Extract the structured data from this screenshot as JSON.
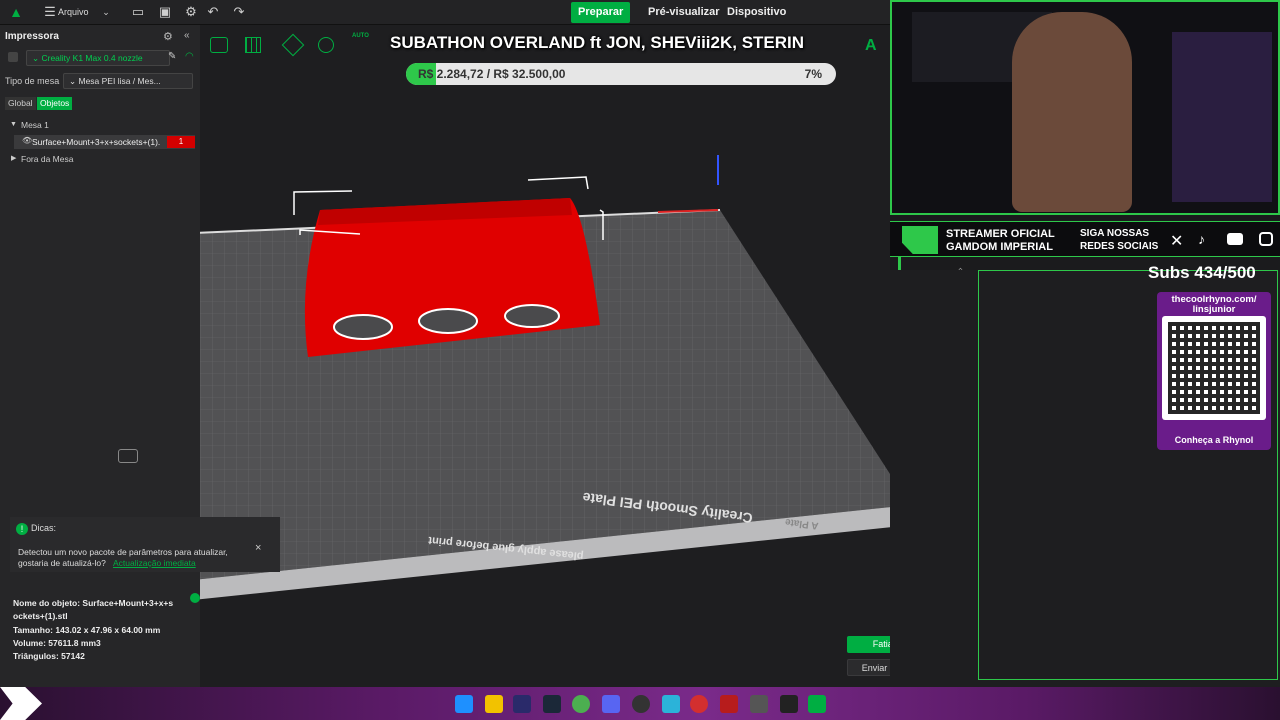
{
  "topbar": {
    "menu_label": "Arquivo",
    "modes": [
      "Preparar",
      "Pré-visualizar",
      "Dispositivo"
    ]
  },
  "overlay": {
    "banner": "SUBATHON OVERLAND ft JON, SHEViii2K, STERIN",
    "goal_text": "R$ 2.284,72 / R$ 32.500,00",
    "goal_percent_label": "7%",
    "goal_fraction": 0.07,
    "streamer_line1": "STREAMER OFICIAL",
    "streamer_line2": "GAMDOM IMPERIAL",
    "social_line1": "SIGA NOSSAS",
    "social_line2": "REDES SOCIAIS",
    "subs": "Subs 434/500",
    "qr_title": "thecoolrhyno.com/ linsjunior",
    "qr_caption": "Conheça a Rhynol"
  },
  "left_panel": {
    "printer_header": "Impressora",
    "printer_value": "Creality K1 Max 0.4 nozzle",
    "bed_label": "Tipo de mesa",
    "bed_value": "Mesa PEI lisa / Mes...",
    "tab_global": "Global",
    "tab_objects": "Objetos",
    "plate_label": "Mesa 1",
    "object_name": "Surface+Mount+3+x+sockets+(1).",
    "object_badge": "1",
    "outside_label": "Fora da Mesa"
  },
  "tips": {
    "title": "Dicas:",
    "text": "Detectou um novo pacote de parâmetros para atualizar, gostaria de atualizá-lo?",
    "link": "Actualização imediata"
  },
  "object_info": {
    "name_line": "Nome do objeto: Surface+Mount+3+x+s",
    "name_line2": "ockets+(1).stl",
    "size": "Tamanho: 143.02 x 47.96 x 64.00 mm",
    "volume": "Volume: 57611.8 mm3",
    "triangles": "Triângulos: 57142"
  },
  "plate_text": {
    "plate_name": "Creality Smooth PEI Plate",
    "glue_note": "please apply glue before print",
    "a_plate": "A Plate"
  },
  "actions": {
    "slice": "Fatiar Mesa",
    "send": "Enviar impressão"
  },
  "colors": {
    "accent": "#00ae42",
    "model": "#e00000",
    "panel": "#262628",
    "background": "#1e1e20"
  }
}
